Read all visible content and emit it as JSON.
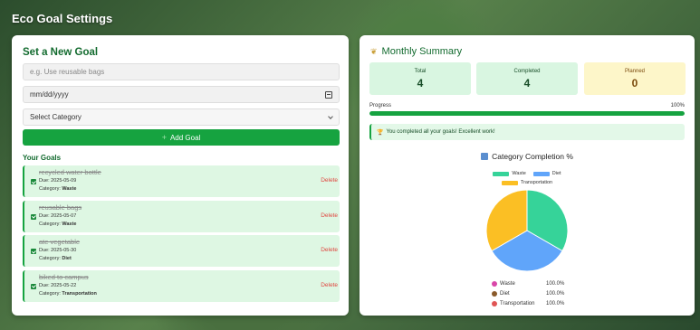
{
  "app": {
    "title": "Eco Goal Settings"
  },
  "form": {
    "heading": "Set a New Goal",
    "goal_placeholder": "e.g. Use reusable bags",
    "date_placeholder": "mm/dd/yyyy",
    "category_selected": "Select Category",
    "add_label": "Add Goal"
  },
  "goals": {
    "heading": "Your Goals",
    "delete_label": "Delete",
    "category_prefix": "Category:",
    "items": [
      {
        "name": "recycled water bottle",
        "due": "Due: 2025-05-09",
        "category": "Waste",
        "done": true
      },
      {
        "name": "reusable bags",
        "due": "Due: 2025-05-07",
        "category": "Waste",
        "done": true
      },
      {
        "name": "ate vegetable",
        "due": "Due: 2025-05-30",
        "category": "Diet",
        "done": true
      },
      {
        "name": "biked to campus",
        "due": "Due: 2025-05-22",
        "category": "Transportation",
        "done": true
      }
    ]
  },
  "summary": {
    "heading": "Monthly Summary",
    "total_label": "Total",
    "total_value": "4",
    "completed_label": "Completed",
    "completed_value": "4",
    "planned_label": "Planned",
    "planned_value": "0",
    "progress_label": "Progress",
    "progress_value": "100%",
    "progress_fraction": 1.0,
    "message": "You completed all your goals! Excellent work!"
  },
  "colors": {
    "accent": "#16a340",
    "waste": "#36d399",
    "diet": "#60a5fa",
    "transportation": "#fbbf24"
  },
  "chart_data": {
    "type": "pie",
    "title": "Category Completion %",
    "legend_placement": "top",
    "series": [
      {
        "name": "Waste",
        "value": 100.0,
        "display": "100.0%",
        "color": "#36d399"
      },
      {
        "name": "Diet",
        "value": 100.0,
        "display": "100.0%",
        "color": "#60a5fa"
      },
      {
        "name": "Transportation",
        "value": 100.0,
        "display": "100.0%",
        "color": "#fbbf24"
      }
    ]
  }
}
